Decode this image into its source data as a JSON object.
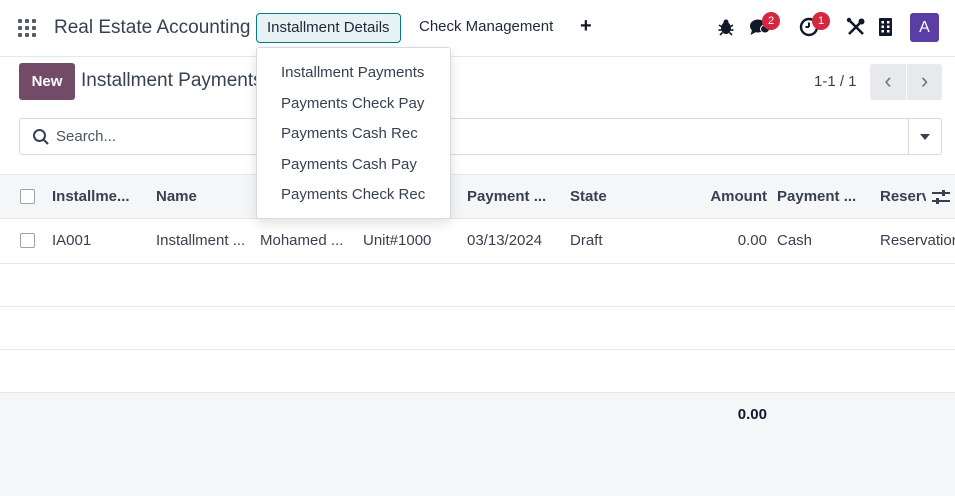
{
  "navbar": {
    "brand": "Real Estate Accounting",
    "menus": [
      "Installment Details",
      "Check Management"
    ],
    "add_icon": "+",
    "chat_badge": "2",
    "activity_badge": "1",
    "avatar_letter": "A"
  },
  "dropdown": {
    "items": [
      "Installment Payments",
      "Payments Check Pay",
      "Payments Cash Rec",
      "Payments Cash Pay",
      "Payments Check Rec"
    ]
  },
  "control": {
    "new_label": "New",
    "title": "Installment Payments",
    "pager": "1-1 / 1",
    "prev_icon": "‹",
    "next_icon": "›"
  },
  "search": {
    "placeholder": "Search..."
  },
  "table": {
    "columns": [
      "Installme...",
      "Name",
      "",
      "",
      "Payment ...",
      "State",
      "Amount",
      "Payment ...",
      "Reserv"
    ],
    "rows": [
      [
        "IA001",
        "Installment ...",
        "Mohamed ...",
        "Unit#1000",
        "03/13/2024",
        "Draft",
        "0.00",
        "Cash",
        "Reservation"
      ]
    ],
    "total_amount": "0.00"
  },
  "icons": [
    "apps-grid-icon",
    "bug-icon",
    "chat-icon",
    "activity-clock-icon",
    "tools-icon",
    "building-icon",
    "search-icon",
    "chevron-down-icon",
    "column-options-icon"
  ]
}
